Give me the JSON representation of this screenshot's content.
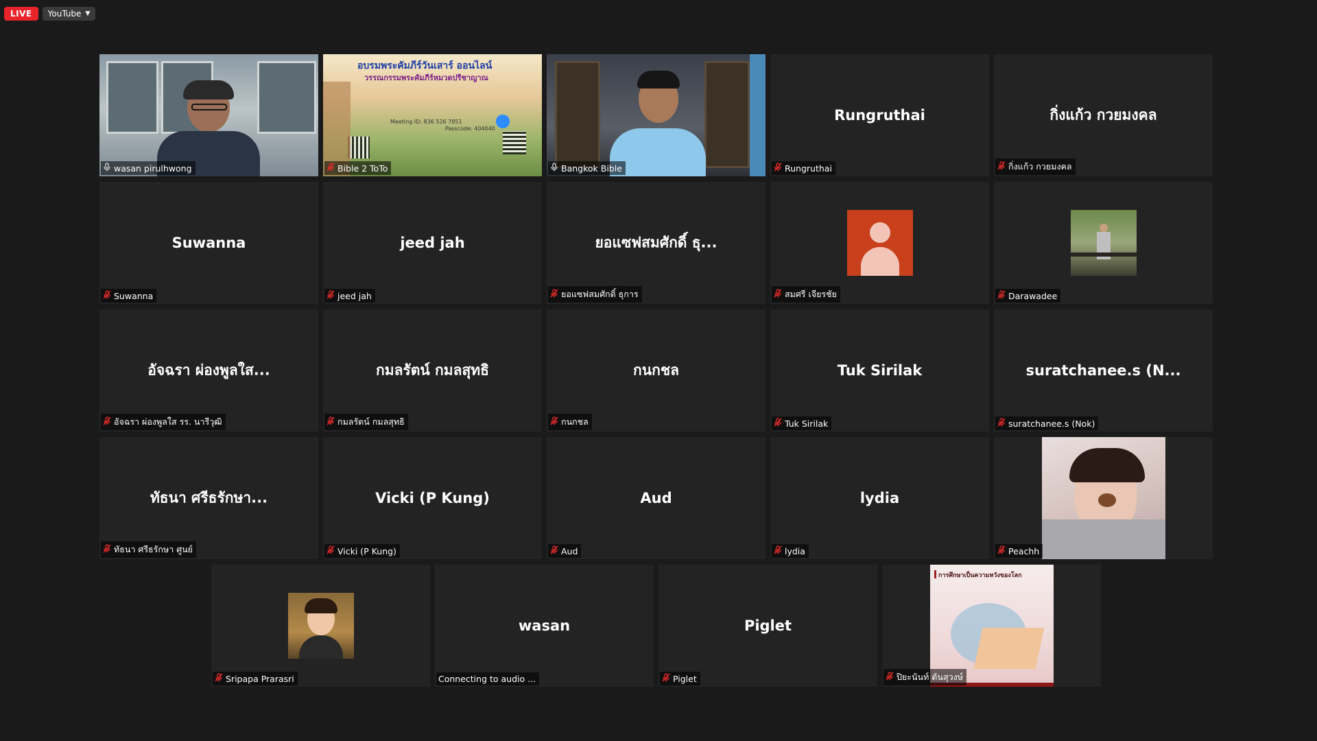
{
  "toolbar": {
    "live_label": "LIVE",
    "stream_target": "YouTube"
  },
  "poster": {
    "title": "อบรมพระคัมภีร์วันเสาร์ ออนไลน์",
    "subtitle": "วรรณกรรมพระคัมภีร์หมวดปรีชาญาณ",
    "meeting_id": "Meeting ID: 836 526 7851",
    "passcode": "Passcode: 404040"
  },
  "participants": [
    {
      "tile_name": "",
      "label": "wasan pirulhwong",
      "kind": "video-office",
      "active": true,
      "muted": false
    },
    {
      "tile_name": "",
      "label": "Bible 2 ToTo",
      "kind": "video-poster",
      "active": false,
      "muted": true
    },
    {
      "tile_name": "",
      "label": "Bangkok Bible",
      "kind": "video-bangkok",
      "active": false,
      "muted": false
    },
    {
      "tile_name": "Rungruthai",
      "label": "Rungruthai",
      "kind": "name",
      "muted": true
    },
    {
      "tile_name": "กิ่งแก้ว  กวยมงคล",
      "label": "กิ่งแก้ว  กวยมงคล",
      "kind": "name",
      "muted": true
    },
    {
      "tile_name": "Suwanna",
      "label": "Suwanna",
      "kind": "name",
      "muted": true
    },
    {
      "tile_name": "jeed jah",
      "label": "jeed jah",
      "kind": "name",
      "muted": true
    },
    {
      "tile_name": "ยอแซฟสมศักดิ์  ธุ...",
      "label": "ยอแซฟสมศักดิ์  ธุการ",
      "kind": "name",
      "muted": true
    },
    {
      "tile_name": "",
      "label": "สมศรี เจียรชัย",
      "kind": "default-avatar",
      "muted": true
    },
    {
      "tile_name": "",
      "label": "Darawadee",
      "kind": "photo-park",
      "muted": true
    },
    {
      "tile_name": "อัจฉรา  ผ่องพูลใส...",
      "label": "อัจฉรา  ผ่องพูลใส  รร. นารีวุฒิ",
      "kind": "name",
      "muted": true
    },
    {
      "tile_name": "กมลรัตน์ กมลสุทธิ",
      "label": "กมลรัตน์ กมลสุทธิ",
      "kind": "name",
      "muted": true
    },
    {
      "tile_name": "กนกชล",
      "label": "กนกชล",
      "kind": "name",
      "muted": true
    },
    {
      "tile_name": "Tuk Sirilak",
      "label": "Tuk Sirilak",
      "kind": "name",
      "muted": true
    },
    {
      "tile_name": "suratchanee.s  (N...",
      "label": "suratchanee.s (Nok)",
      "kind": "name",
      "muted": true
    },
    {
      "tile_name": "ทัธนา  ศรีธรักษา...",
      "label": "ทัธนา  ศรีธรักษา  ศูนย์",
      "kind": "name",
      "muted": true
    },
    {
      "tile_name": "Vicki (P Kung)",
      "label": "Vicki (P Kung)",
      "kind": "name",
      "muted": true
    },
    {
      "tile_name": "Aud",
      "label": "Aud",
      "kind": "name",
      "muted": true
    },
    {
      "tile_name": "lydia",
      "label": "lydia",
      "kind": "name",
      "muted": true
    },
    {
      "tile_name": "",
      "label": "Peachh",
      "kind": "photo-selfie",
      "muted": true
    },
    {
      "tile_name": "",
      "label": "Sripapa Prarasri",
      "kind": "photo-portrait",
      "muted": true
    },
    {
      "tile_name": "wasan",
      "label": "Connecting to audio ...",
      "kind": "name",
      "muted": false,
      "no_mic": true
    },
    {
      "tile_name": "Piglet",
      "label": "Piglet",
      "kind": "name",
      "muted": true
    },
    {
      "tile_name": "",
      "label": "ปิยะนันท์ ตันสุวงษ์",
      "kind": "photo-book",
      "muted": true
    }
  ],
  "book_cover_text": "การศึกษาเป็นความหวังของโลก",
  "colors": {
    "active_border": "#f5e340",
    "mute_red": "#e02b2b",
    "live_red": "#e8232a",
    "avatar_orange": "#c8401c"
  }
}
